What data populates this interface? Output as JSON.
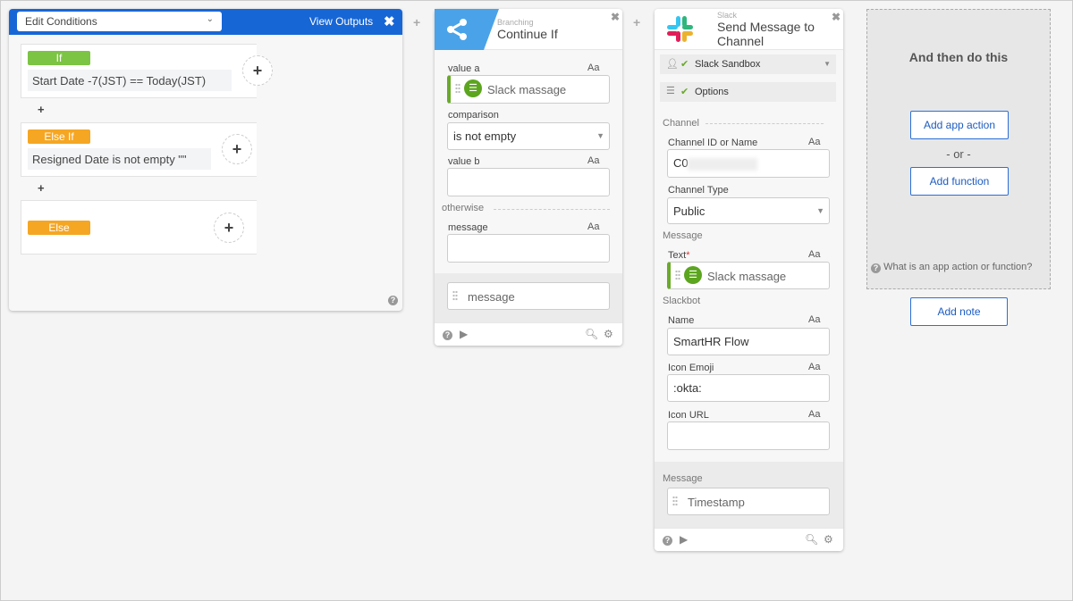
{
  "conditions_panel": {
    "selector": "Edit Conditions",
    "view_outputs": "View Outputs",
    "blocks": [
      {
        "badge": "If",
        "expression": "Start Date -7(JST)  ==  Today(JST)",
        "color": "#7cc443"
      },
      {
        "badge": "Else If",
        "expression": "Resigned Date  is not empty  \"\"",
        "color": "#f5a623"
      },
      {
        "badge": "Else",
        "expression": "",
        "color": "#f5a623"
      }
    ]
  },
  "branching": {
    "category": "Branching",
    "title": "Continue If",
    "value_a_label": "value a",
    "value_a": "Slack massage",
    "comparison_label": "comparison",
    "comparison": "is not empty",
    "value_b_label": "value b",
    "value_b": "",
    "otherwise_label": "otherwise",
    "message_label": "message",
    "message_value": "",
    "output": "message",
    "aa": "Aa"
  },
  "slack": {
    "category": "Slack",
    "title": "Send Message to Channel",
    "account": "Slack Sandbox",
    "options": "Options",
    "channel_section": "Channel",
    "channel_id_label": "Channel ID or Name",
    "channel_id": "C0",
    "channel_type_label": "Channel Type",
    "channel_type": "Public",
    "message_section": "Message",
    "text_label": "Text",
    "text_value": "Slack massage",
    "slackbot_section": "Slackbot",
    "name_label": "Name",
    "name_value": "SmartHR Flow",
    "icon_emoji_label": "Icon Emoji",
    "icon_emoji": ":okta:",
    "icon_url_label": "Icon URL",
    "icon_url": "",
    "output_section": "Message",
    "output": "Timestamp",
    "aa": "Aa"
  },
  "next_step": {
    "title": "And then do this",
    "add_app_action": "Add app action",
    "or": "- or -",
    "add_function": "Add function",
    "help": "What is an app action or function?",
    "add_note": "Add note"
  }
}
